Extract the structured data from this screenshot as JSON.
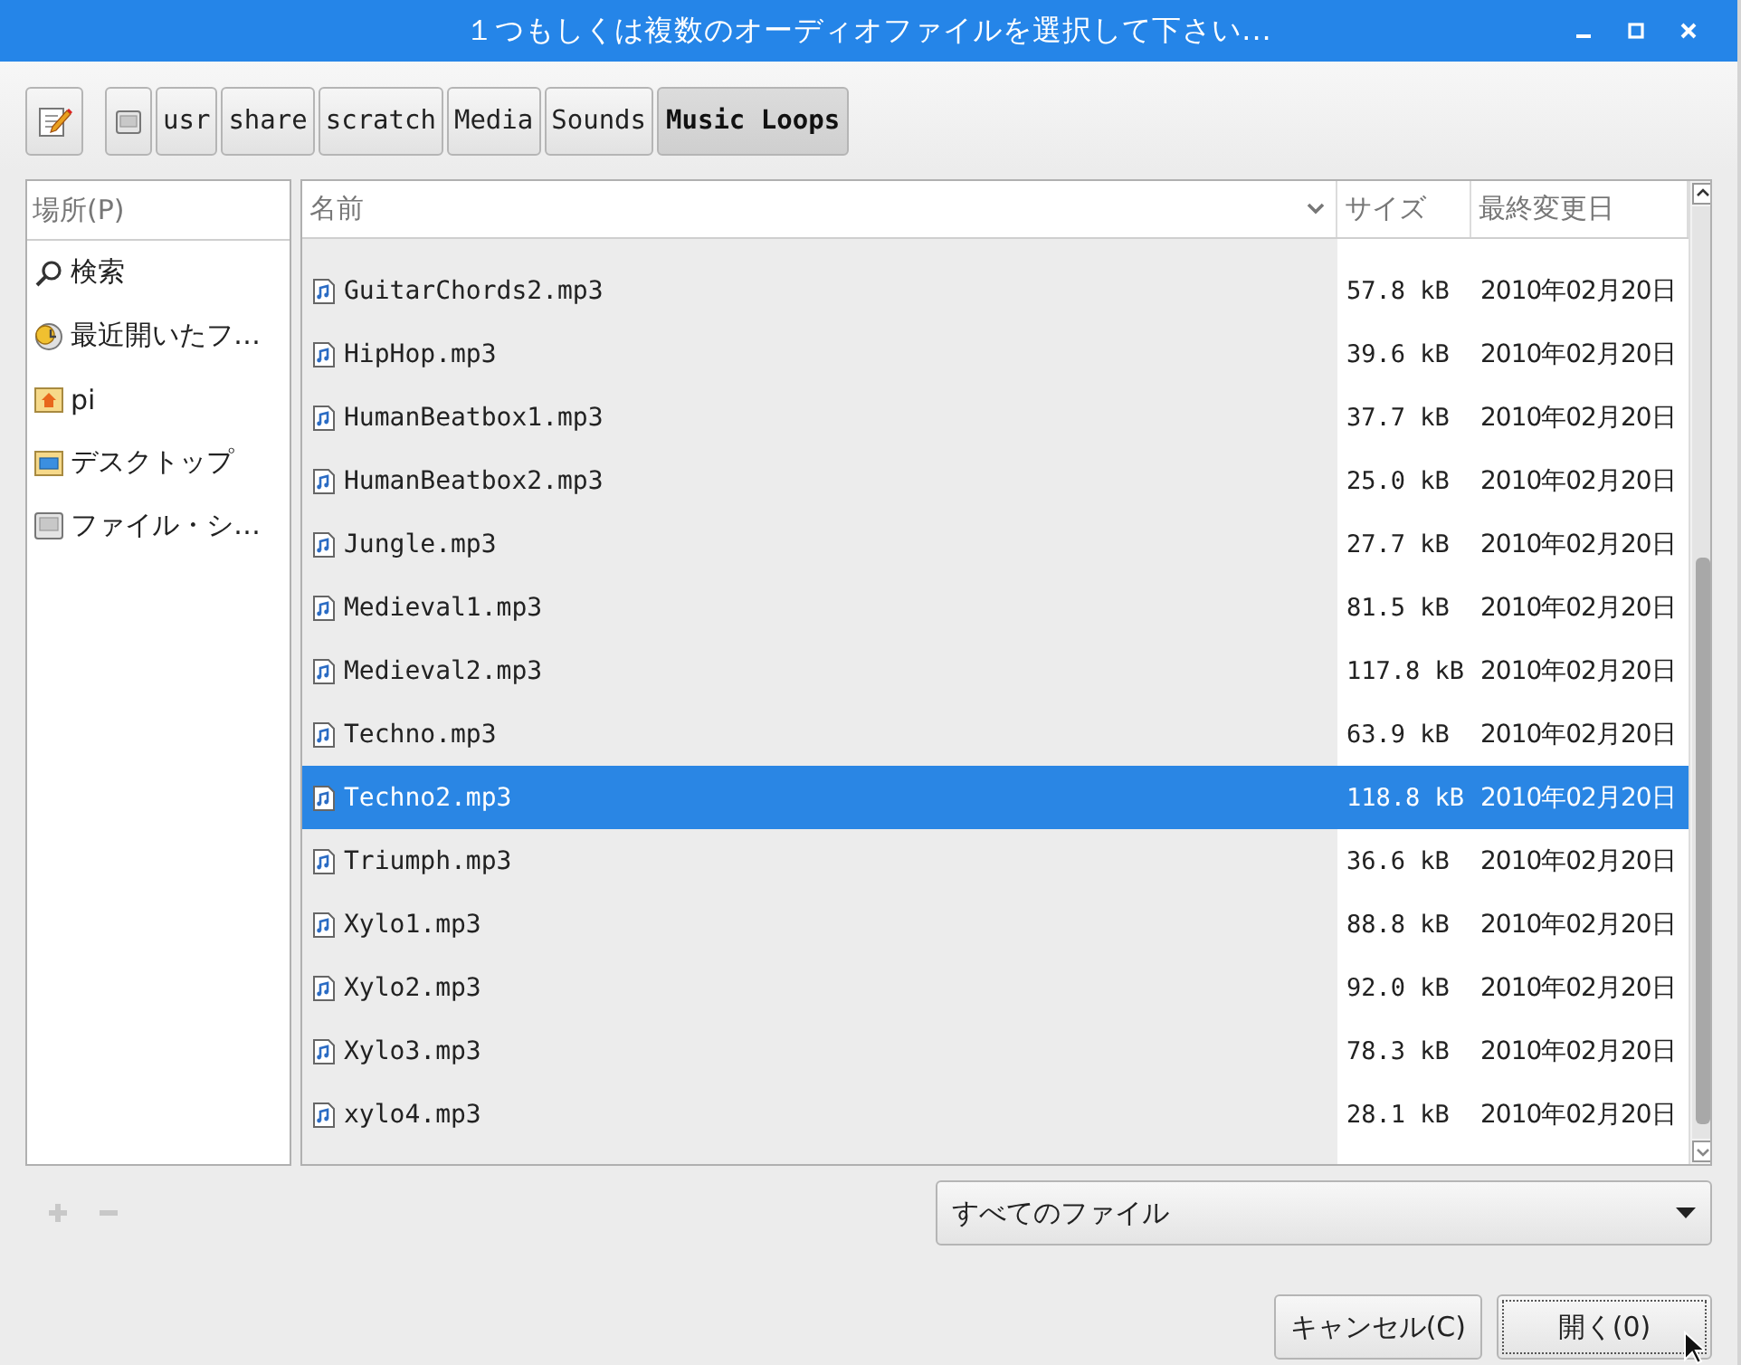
{
  "window": {
    "title": "１つもしくは複数のオーディオファイルを選択して下さい..."
  },
  "path_bar": [
    {
      "label": "usr",
      "selected": false
    },
    {
      "label": "share",
      "selected": false
    },
    {
      "label": "scratch",
      "selected": false
    },
    {
      "label": "Media",
      "selected": false
    },
    {
      "label": "Sounds",
      "selected": false
    },
    {
      "label": "Music Loops",
      "selected": true
    }
  ],
  "places": {
    "header": "場所(P)",
    "items": [
      {
        "kind": "search",
        "label": "検索"
      },
      {
        "kind": "recent",
        "label": "最近開いたフ…"
      },
      {
        "kind": "home",
        "label": "pi"
      },
      {
        "kind": "desktop",
        "label": "デスクトップ"
      },
      {
        "kind": "drive",
        "label": "ファイル・シ…"
      }
    ]
  },
  "table": {
    "columns": [
      "名前",
      "サイズ",
      "最終変更日"
    ],
    "rows": [
      {
        "name": "GuitarChords2.mp3",
        "size": "57.8 kB",
        "modified": "2010年02月20日",
        "selected": false
      },
      {
        "name": "HipHop.mp3",
        "size": "39.6 kB",
        "modified": "2010年02月20日",
        "selected": false
      },
      {
        "name": "HumanBeatbox1.mp3",
        "size": "37.7 kB",
        "modified": "2010年02月20日",
        "selected": false
      },
      {
        "name": "HumanBeatbox2.mp3",
        "size": "25.0 kB",
        "modified": "2010年02月20日",
        "selected": false
      },
      {
        "name": "Jungle.mp3",
        "size": "27.7 kB",
        "modified": "2010年02月20日",
        "selected": false
      },
      {
        "name": "Medieval1.mp3",
        "size": "81.5 kB",
        "modified": "2010年02月20日",
        "selected": false
      },
      {
        "name": "Medieval2.mp3",
        "size": "117.8 kB",
        "modified": "2010年02月20日",
        "selected": false
      },
      {
        "name": "Techno.mp3",
        "size": "63.9 kB",
        "modified": "2010年02月20日",
        "selected": false
      },
      {
        "name": "Techno2.mp3",
        "size": "118.8 kB",
        "modified": "2010年02月20日",
        "selected": true
      },
      {
        "name": "Triumph.mp3",
        "size": "36.6 kB",
        "modified": "2010年02月20日",
        "selected": false
      },
      {
        "name": "Xylo1.mp3",
        "size": "88.8 kB",
        "modified": "2010年02月20日",
        "selected": false
      },
      {
        "name": "Xylo2.mp3",
        "size": "92.0 kB",
        "modified": "2010年02月20日",
        "selected": false
      },
      {
        "name": "Xylo3.mp3",
        "size": "78.3 kB",
        "modified": "2010年02月20日",
        "selected": false
      },
      {
        "name": "xylo4.mp3",
        "size": "28.1 kB",
        "modified": "2010年02月20日",
        "selected": false
      }
    ]
  },
  "filter": {
    "value": "すべてのファイル"
  },
  "buttons": [
    "キャンセル(C)",
    "開く(0)"
  ]
}
